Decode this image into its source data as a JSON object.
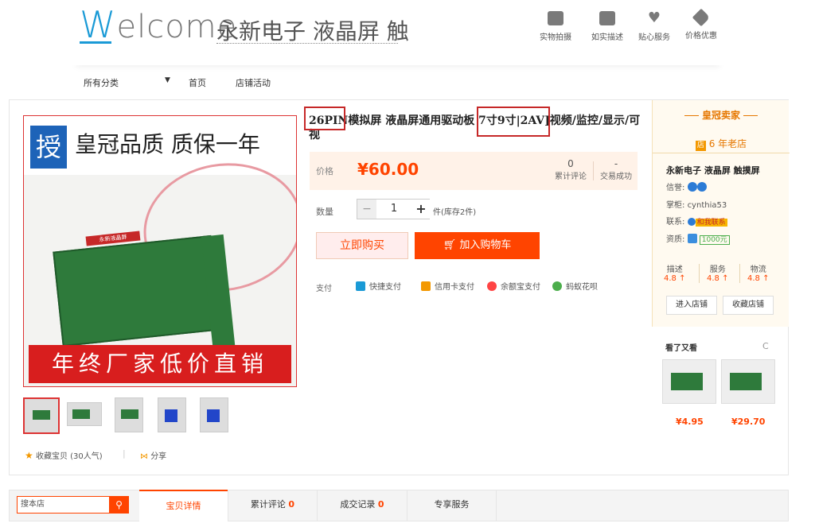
{
  "header": {
    "logo_w": "W",
    "logo_rest": "elcome",
    "shop_name": "永新电子 液晶屏 触",
    "services": [
      {
        "label": "实物拍摄",
        "icon": "camera-icon"
      },
      {
        "label": "如实描述",
        "icon": "document-icon"
      },
      {
        "label": "贴心服务",
        "icon": "heart-icon"
      },
      {
        "label": "价格优惠",
        "icon": "tag-icon"
      }
    ]
  },
  "nav": {
    "all_categories": "所有分类",
    "arrow": "▼",
    "home": "首页",
    "promotions": "店铺活动"
  },
  "gallery": {
    "badge": "授",
    "headline": "皇冠品质 质保一年",
    "label": "永新液晶屏",
    "banner": "年终厂家低价直销",
    "favorite": "收藏宝贝 (30人气)",
    "favorite_sep": "|",
    "share": "分享"
  },
  "product": {
    "title": "26PIN模拟屏 液晶屏通用驱动板 7寸9寸|2AV]视频/监控/显示/可视",
    "price_label": "价格",
    "price": "¥60.00",
    "reviews_count": "0",
    "reviews_label": "累计评论",
    "deals_count": "-",
    "deals_label": "交易成功",
    "qty_label": "数量",
    "qty_minus": "−",
    "qty_value": "1",
    "qty_plus": "+",
    "stock": "件(库存2件)",
    "buy_now": "立即购买",
    "add_cart": "加入购物车",
    "pay_label": "支付",
    "pay_methods": [
      "快捷支付",
      "信用卡支付",
      "余额宝支付",
      "蚂蚁花呗"
    ]
  },
  "seller": {
    "crown": "皇冠卖家",
    "years_icon": "店",
    "years": "6 年老店",
    "name": "永新电子 液晶屏 触摸屏",
    "credit_label": "信誉:",
    "owner_label": "掌柜:",
    "owner": "cynthia53",
    "contact_label": "联系:",
    "contact": "和我联系",
    "qual_label": "资质:",
    "deposit": "1000元",
    "ratings": [
      {
        "label": "描述",
        "value": "4.8 ↑"
      },
      {
        "label": "服务",
        "value": "4.8 ↑"
      },
      {
        "label": "物流",
        "value": "4.8 ↑"
      }
    ],
    "enter_shop": "进入店铺",
    "fav_shop": "收藏店铺"
  },
  "also_viewed": {
    "title": "看了又看",
    "refresh": "C",
    "prices": [
      "¥4.95",
      "¥29.70"
    ]
  },
  "bottom": {
    "search_placeholder": "搜本店",
    "search_icon": "⚲",
    "tabs": [
      {
        "label": "宝贝详情",
        "count": ""
      },
      {
        "label": "累计评论",
        "count": "0"
      },
      {
        "label": "成交记录",
        "count": "0"
      },
      {
        "label": "专享服务",
        "count": ""
      }
    ]
  },
  "colors": {
    "accent": "#ff4400",
    "brand_blue": "#1a9ad6",
    "highlight_box": "#c62828"
  }
}
